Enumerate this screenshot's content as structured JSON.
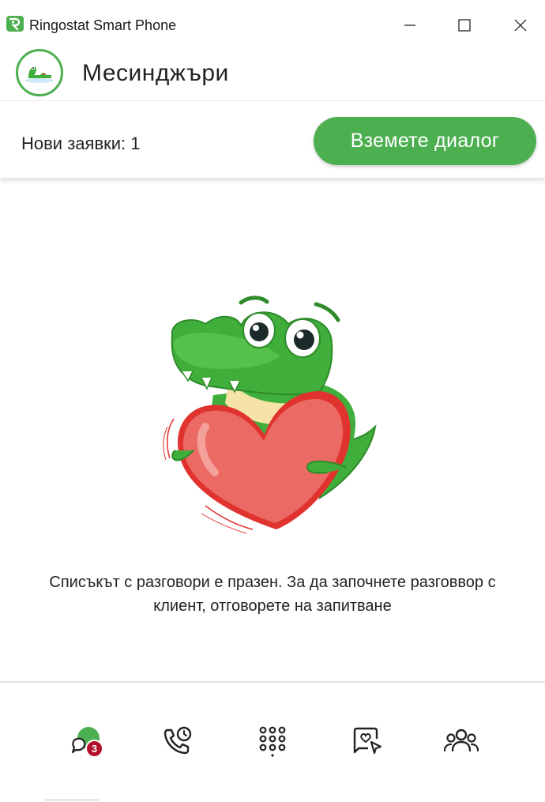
{
  "window": {
    "title": "Ringostat Smart Phone",
    "controls": [
      "minimize-icon",
      "maximize-icon",
      "close-icon"
    ]
  },
  "header": {
    "title": "Месинджъри",
    "avatar_icon": "crocodile-avatar"
  },
  "requests": {
    "label": "Нови заявки: 1",
    "take_button": "Вземете диалог"
  },
  "empty_state": {
    "illustration": "crocodile-heart-illustration",
    "message": "Списъкът с разговори е празен. За да започнете разговвор с клиент, отговорете на запитване"
  },
  "nav": {
    "items": [
      {
        "icon": "messengers-icon",
        "badge": "3"
      },
      {
        "icon": "call-history-icon"
      },
      {
        "icon": "dialpad-icon"
      },
      {
        "icon": "chat-widget-icon"
      },
      {
        "icon": "contacts-icon"
      }
    ]
  },
  "colors": {
    "accent": "#4caf50",
    "badge": "#b3102a",
    "heart": "#e8524f",
    "croc": "#3fae3a"
  }
}
